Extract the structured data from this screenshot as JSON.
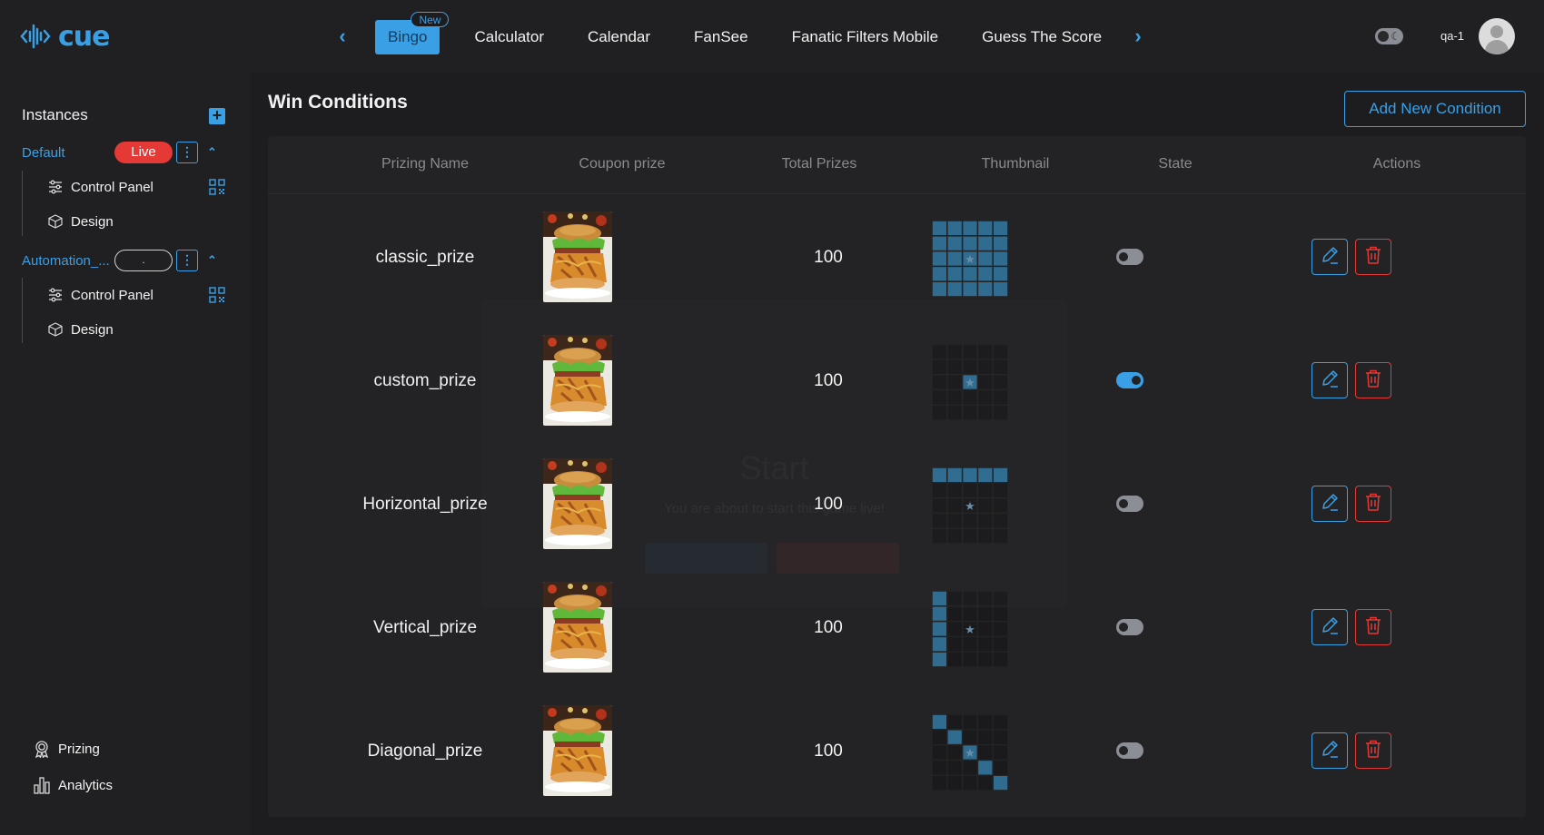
{
  "brand": {
    "name": "cue",
    "accent": "#3aa0e6"
  },
  "nav": {
    "tabs": [
      {
        "label": "Bingo",
        "badge": "New",
        "active": true
      },
      {
        "label": "Calculator"
      },
      {
        "label": "Calendar"
      },
      {
        "label": "FanSee"
      },
      {
        "label": "Fanatic Filters Mobile"
      },
      {
        "label": "Guess The Score"
      }
    ]
  },
  "user": {
    "name": "qa-1"
  },
  "sidebar": {
    "title": "Instances",
    "instances": [
      {
        "name": "Default",
        "status": "Live",
        "items": [
          {
            "label": "Control Panel"
          },
          {
            "label": "Design"
          }
        ]
      },
      {
        "name": "Automation_...",
        "status": ".",
        "items": [
          {
            "label": "Control Panel"
          },
          {
            "label": "Design"
          }
        ]
      }
    ],
    "bottom": [
      {
        "label": "Prizing"
      },
      {
        "label": "Analytics"
      }
    ]
  },
  "main": {
    "title": "Win Conditions",
    "add_button": "Add New Condition",
    "columns": [
      "Prizing Name",
      "Coupon prize",
      "Total Prizes",
      "Thumbnail",
      "State",
      "Actions"
    ],
    "rows": [
      {
        "name": "classic_prize",
        "total": "100",
        "state": false,
        "pattern": "classic"
      },
      {
        "name": "custom_prize",
        "total": "100",
        "state": true,
        "pattern": "custom"
      },
      {
        "name": "Horizontal_prize",
        "total": "100",
        "state": false,
        "pattern": "horizontal"
      },
      {
        "name": "Vertical_prize",
        "total": "100",
        "state": false,
        "pattern": "vertical"
      },
      {
        "name": "Diagonal_prize",
        "total": "100",
        "state": false,
        "pattern": "diagonal"
      }
    ]
  },
  "modal_ghost": {
    "title": "Start",
    "subtitle": "You are about to start this game live!"
  }
}
